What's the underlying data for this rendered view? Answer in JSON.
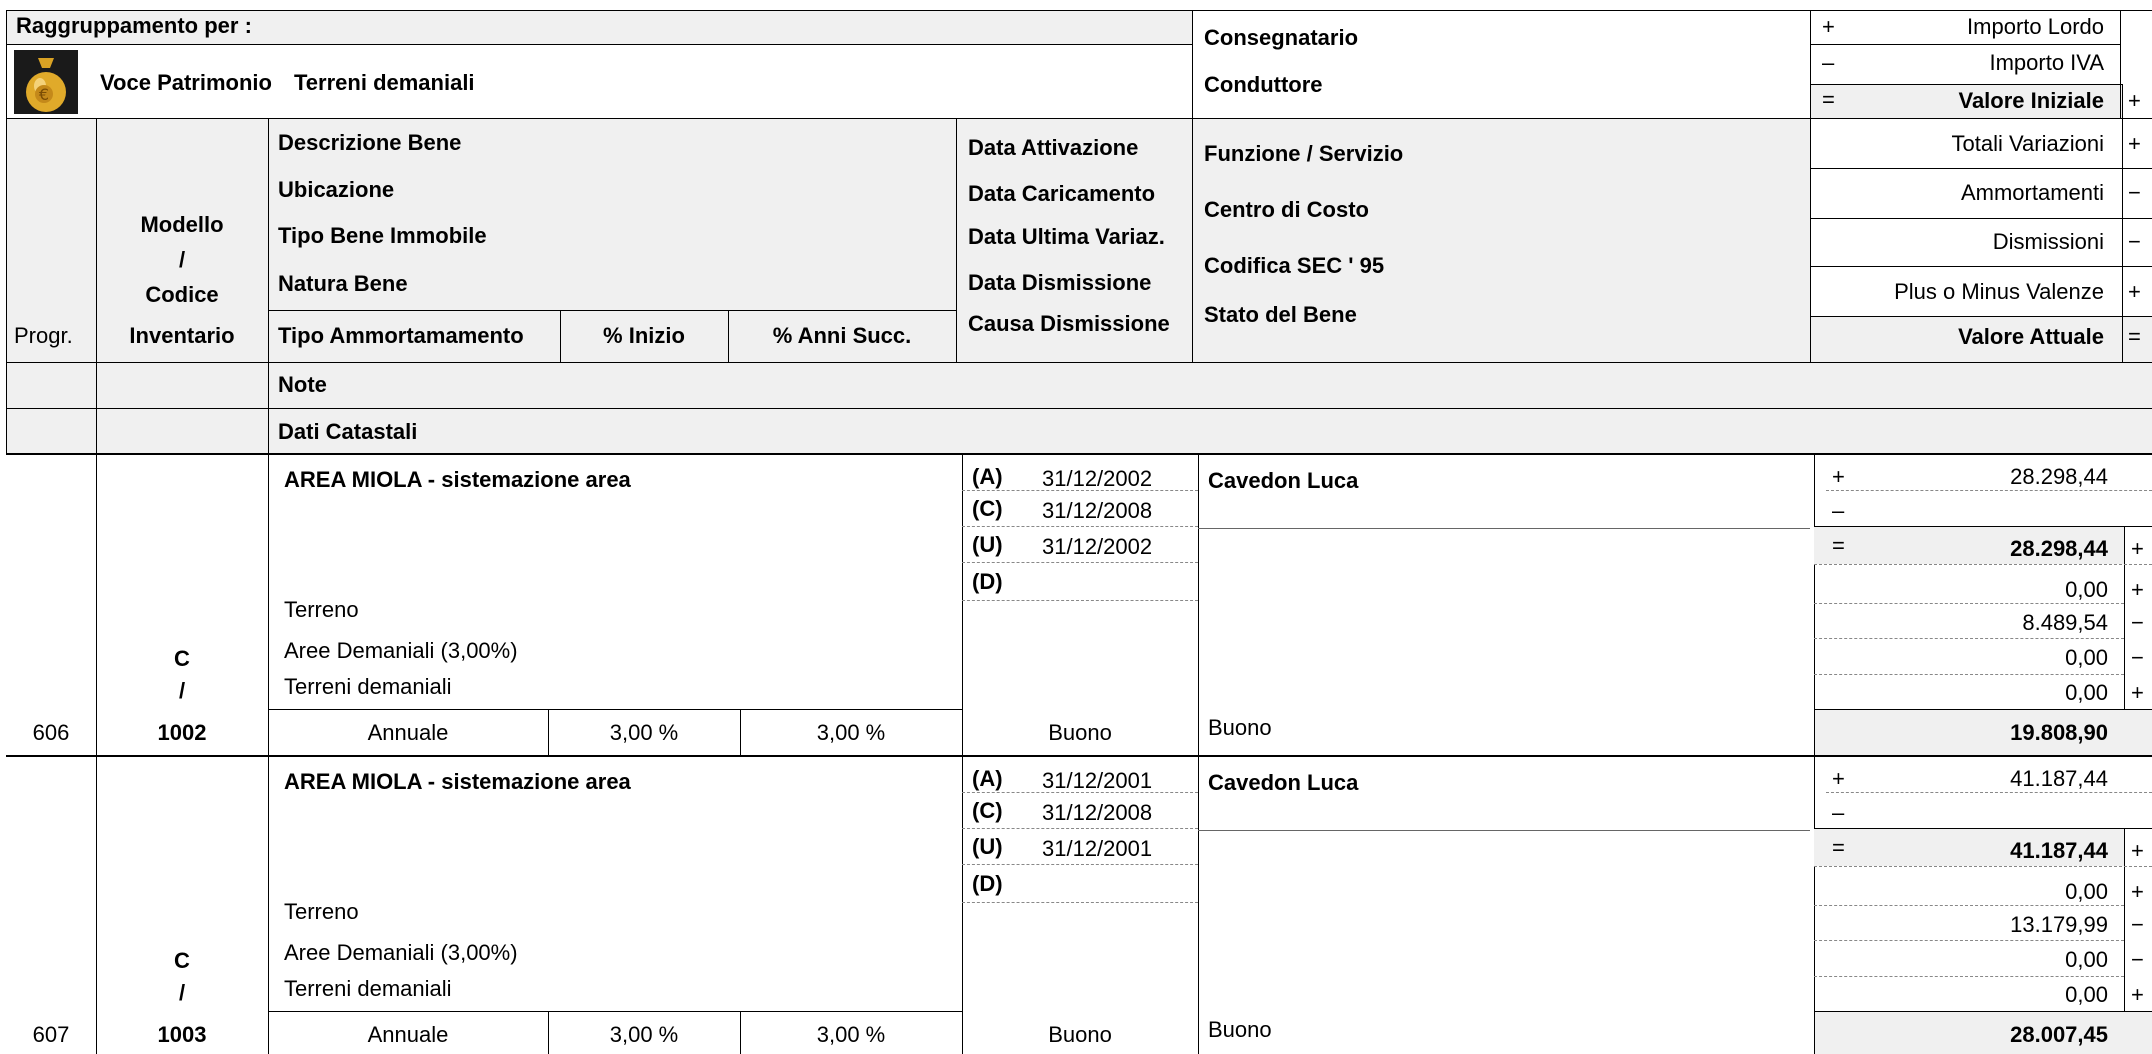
{
  "header": {
    "group_label": "Raggruppamento per :",
    "voce_label": "Voce Patrimonio",
    "voce_value": "Terreni demaniali",
    "consegnatario": "Consegnatario",
    "conduttore": "Conduttore",
    "importo_lordo_sign": "+",
    "importo_lordo": "Importo Lordo",
    "importo_iva_sign": "–",
    "importo_iva": "Importo IVA",
    "valore_iniziale_sign": "=",
    "valore_iniziale": "Valore Iniziale",
    "valore_iniziale_right": "+",
    "progr": "Progr.",
    "modello_1": "Modello",
    "modello_2": "/",
    "modello_3": "Codice",
    "modello_4": "Inventario",
    "descrizione": "Descrizione Bene",
    "ubicazione": "Ubicazione",
    "tipo_bene": "Tipo Bene Immobile",
    "natura": "Natura Bene",
    "tipo_amm": "Tipo  Ammortamamento",
    "perc_inizio": "% Inizio",
    "perc_anni": "% Anni Succ.",
    "data_attivazione": "Data Attivazione",
    "data_caricamento": "Data Caricamento",
    "data_ultima": "Data Ultima Variaz.",
    "data_dismissione": "Data Dismissione",
    "causa_dismissione": "Causa Dismissione",
    "funzione": "Funzione / Servizio",
    "centro_costo": "Centro di Costo",
    "codifica": "Codifica SEC ' 95",
    "stato": "Stato del Bene",
    "totali_variazioni": "Totali Variazioni",
    "totali_sign": "+",
    "ammortamenti": "Ammortamenti",
    "ammortamenti_sign": "−",
    "dismissioni": "Dismissioni",
    "dismissioni_sign": "−",
    "plus_minus": "Plus o Minus Valenze",
    "plus_minus_sign": "+",
    "valore_attuale": "Valore Attuale",
    "valore_attuale_sign": "=",
    "note": "Note",
    "dati_catastali": "Dati Catastali"
  },
  "records": [
    {
      "progr": "606",
      "modello": "C",
      "slash": "/",
      "codice": "1002",
      "descrizione": "AREA MIOLA - sistemazione area",
      "tipo_bene": "Terreno",
      "natura": "Aree Demaniali (3,00%)",
      "voce": "Terreni demaniali",
      "tipo_amm": "Annuale",
      "perc_inizio": "3,00 %",
      "perc_anni": "3,00 %",
      "a_label": "(A)",
      "a_date": "31/12/2002",
      "c_label": "(C)",
      "c_date": "31/12/2008",
      "u_label": "(U)",
      "u_date": "31/12/2002",
      "d_label": "(D)",
      "causa": "Buono",
      "consegnatario": "Cavedon Luca",
      "stato": "Buono",
      "lordo_sign": "+",
      "lordo": "28.298,44",
      "iva_sign": "–",
      "iniziale_sign": "=",
      "iniziale": "28.298,44",
      "iniziale_right": "+",
      "variazioni": "0,00",
      "variazioni_sign": "+",
      "ammortamenti": "8.489,54",
      "ammortamenti_sign": "−",
      "dismissioni": "0,00",
      "dismissioni_sign": "−",
      "plusminus": "0,00",
      "plusminus_sign": "+",
      "attuale": "19.808,90"
    },
    {
      "progr": "607",
      "modello": "C",
      "slash": "/",
      "codice": "1003",
      "descrizione": "AREA MIOLA - sistemazione area",
      "tipo_bene": "Terreno",
      "natura": "Aree Demaniali (3,00%)",
      "voce": "Terreni demaniali",
      "tipo_amm": "Annuale",
      "perc_inizio": "3,00 %",
      "perc_anni": "3,00 %",
      "a_label": "(A)",
      "a_date": "31/12/2001",
      "c_label": "(C)",
      "c_date": "31/12/2008",
      "u_label": "(U)",
      "u_date": "31/12/2001",
      "d_label": "(D)",
      "causa": "Buono",
      "consegnatario": "Cavedon Luca",
      "stato": "Buono",
      "lordo_sign": "+",
      "lordo": "41.187,44",
      "iva_sign": "–",
      "iniziale_sign": "=",
      "iniziale": "41.187,44",
      "iniziale_right": "+",
      "variazioni": "0,00",
      "variazioni_sign": "+",
      "ammortamenti": "13.179,99",
      "ammortamenti_sign": "−",
      "dismissioni": "0,00",
      "dismissioni_sign": "−",
      "plusminus": "0,00",
      "plusminus_sign": "+",
      "attuale": "28.007,45"
    }
  ]
}
